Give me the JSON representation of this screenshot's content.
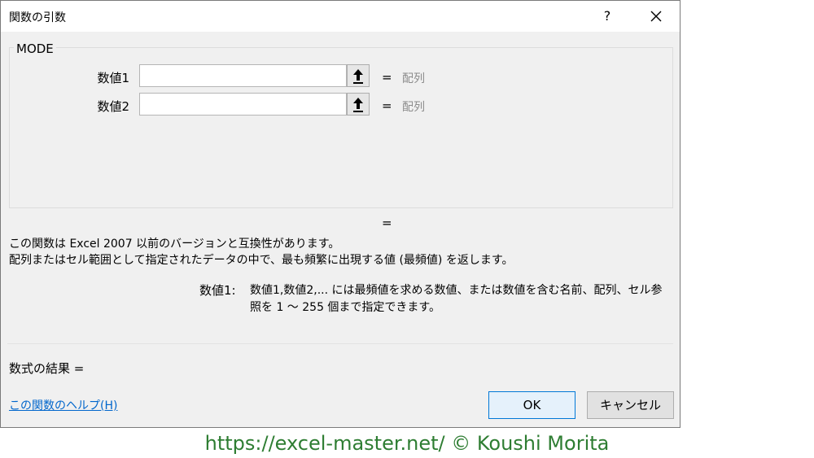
{
  "dialog": {
    "title": "関数の引数",
    "help_button": "?",
    "function_name": "MODE",
    "args": [
      {
        "label": "数値1",
        "value": "",
        "equals": "=",
        "type": "配列"
      },
      {
        "label": "数値2",
        "value": "",
        "equals": "=",
        "type": "配列"
      }
    ],
    "result_equals": "=",
    "description_line1": "この関数は Excel 2007 以前のバージョンと互換性があります。",
    "description_line2": "配列またはセル範囲として指定されたデータの中で、最も頻繁に出現する値 (最頻値) を返します。",
    "arg_help_label": "数値1:",
    "arg_help_line1": "数値1,数値2,... には最頻値を求める数値、または数値を含む名前、配列、セル参",
    "arg_help_line2": "照を 1 〜 255 個まで指定できます。",
    "formula_result": "数式の結果 =",
    "help_link": "この関数のヘルプ(H)",
    "ok_label": "OK",
    "cancel_label": "キャンセル"
  },
  "footer": {
    "text": "https://excel-master.net/  © Koushi Morita",
    "color": "#2e7d32"
  },
  "colors": {
    "link": "#0066cc",
    "ok_border": "#0078d7",
    "placeholder_type": "#8c8c8c"
  }
}
